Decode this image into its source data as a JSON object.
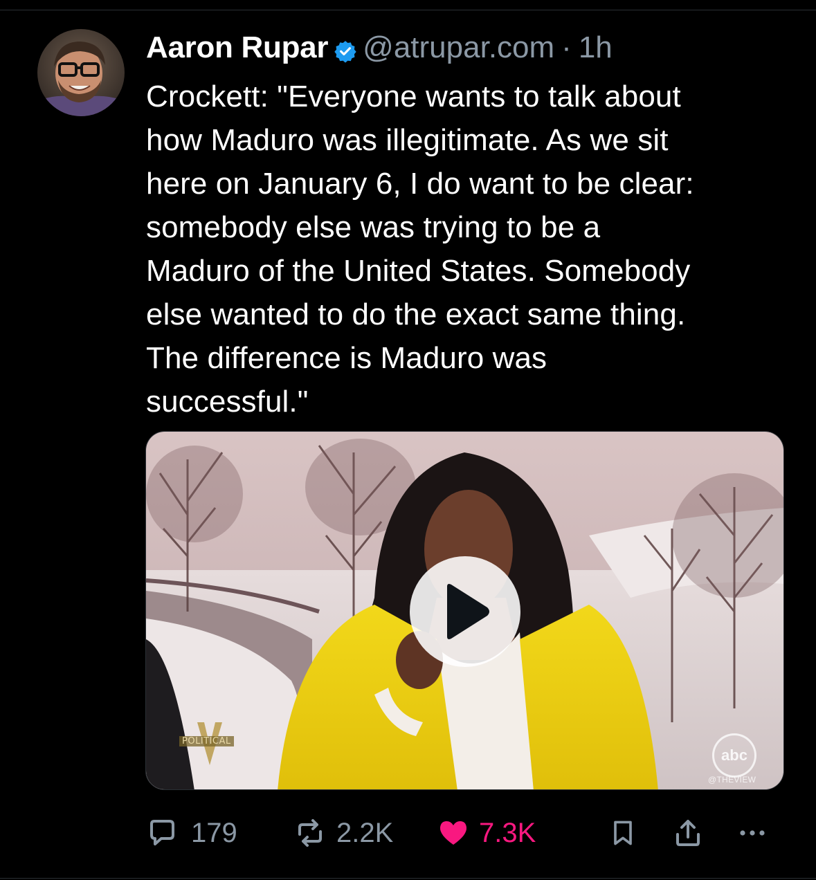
{
  "post": {
    "author_name": "Aaron Rupar",
    "handle": "@atrupar.com",
    "separator": "·",
    "time": "1h",
    "text": "Crockett: \"Everyone wants to talk about\nhow Maduro was illegitimate. As we sit\nhere on January 6, I do want to be clear:\nsomebody else was trying to be a\nMaduro of the United States. Somebody\nelse wanted to do the exact same thing.\nThe difference is Maduro was\nsuccessful.\""
  },
  "media": {
    "type": "video",
    "badge_label": "POLITICAL",
    "network_logo": "abc",
    "network_tag": "@THEVIEW"
  },
  "actions": {
    "replies": "179",
    "reposts": "2.2K",
    "likes": "7.3K"
  },
  "icons": {
    "verified": "verified-badge-icon",
    "reply": "speech-bubble-icon",
    "repost": "repost-arrows-icon",
    "like": "heart-icon",
    "bookmark": "bookmark-icon",
    "share": "share-upload-icon",
    "more": "more-dots-icon",
    "play": "play-icon"
  },
  "colors": {
    "background": "#000000",
    "text": "#ffffff",
    "secondary": "#8b98a5",
    "verified": "#1d9bf0",
    "like": "#f91880"
  }
}
